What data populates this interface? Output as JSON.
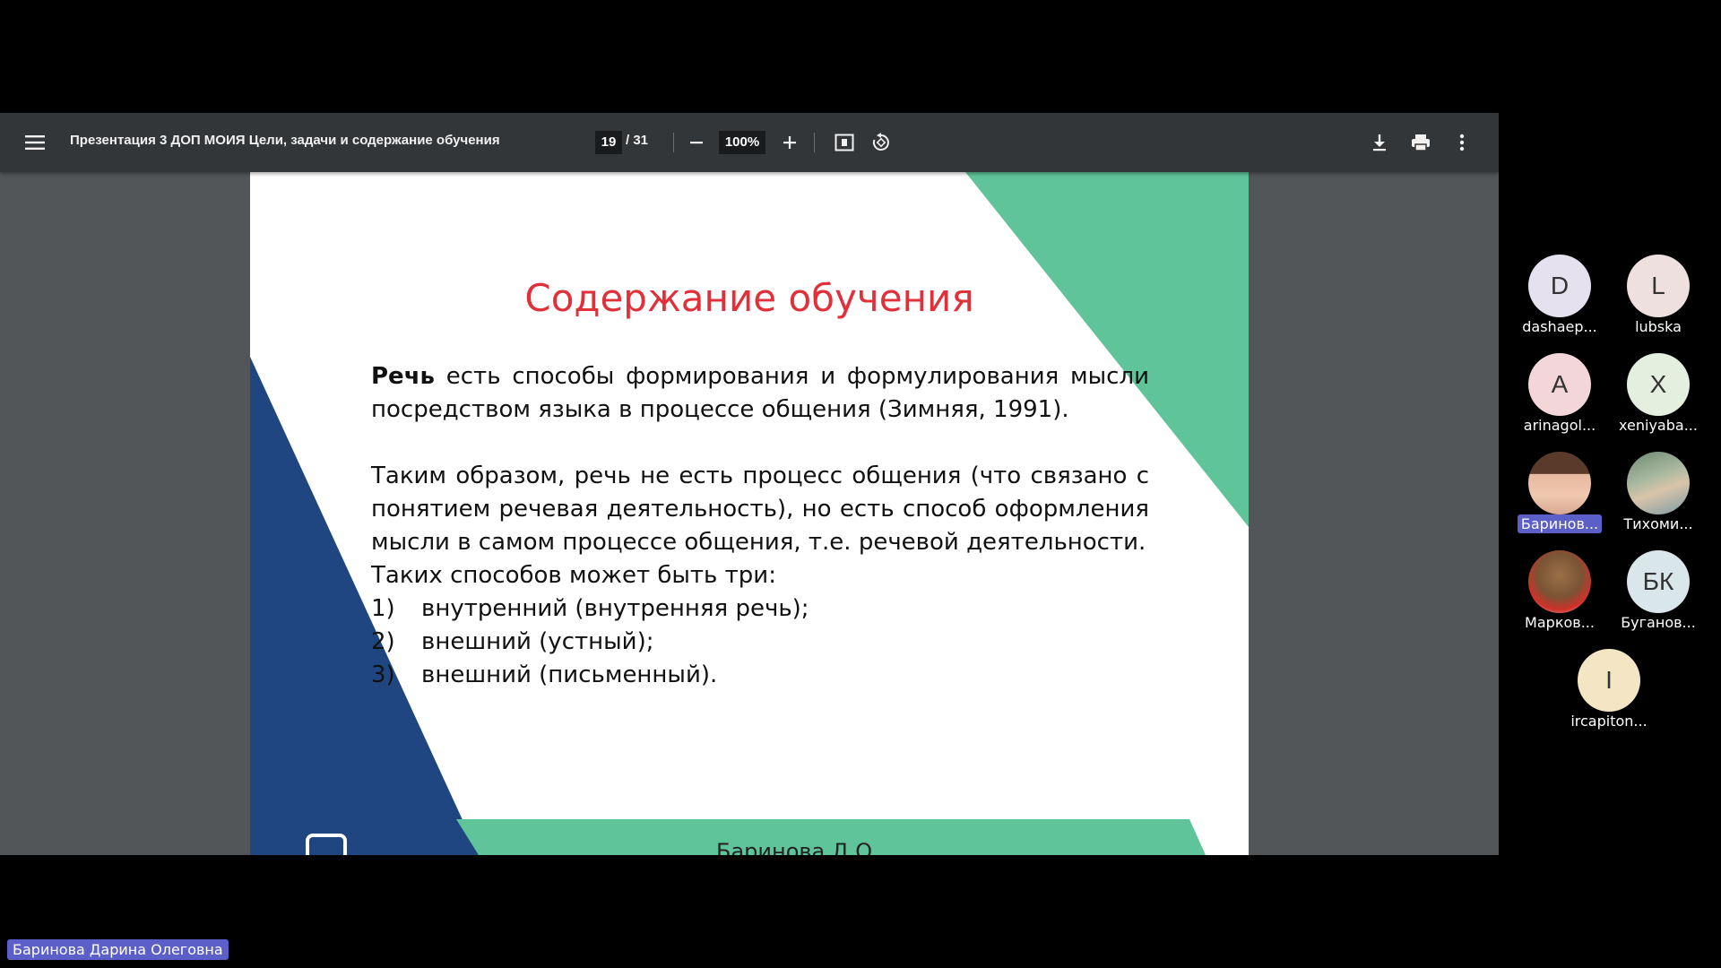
{
  "viewer": {
    "title": "Презентация 3 ДОП МОИЯ Цели, задачи и содержание обучения",
    "current_page": "19",
    "page_total": "/ 31",
    "zoom": "100%"
  },
  "slide": {
    "title": "Содержание обучения",
    "p1_bold": "Речь",
    "p1_rest": " есть способы формирования и формулирования мысли посредством языка в процессе общения (Зимняя, 1991).",
    "p2": "Таким образом, речь не есть процесс общения (что связано с понятием речевая деятельность), но есть способ оформления мысли в самом процессе общения, т.е. речевой деятельности.",
    "p3": "Таких способов может быть три:",
    "list": [
      {
        "num": "1)",
        "text": "внутренний (внутренняя речь);"
      },
      {
        "num": "2)",
        "text": "внешний (устный);"
      },
      {
        "num": "3)",
        "text": "внешний (письменный)."
      }
    ],
    "footer": "Баринова Д.О.",
    "colors": {
      "green": "#5fc49a",
      "blue": "#1f4680",
      "title": "#e0303a"
    }
  },
  "participants": [
    {
      "initial": "D",
      "name": "dashaep...",
      "bg": "#e6e1ef",
      "icon": ""
    },
    {
      "initial": "L",
      "name": "lubska",
      "bg": "#efe0e0",
      "icon": ""
    },
    {
      "initial": "A",
      "name": "arinagol...",
      "bg": "#f2d6da",
      "icon": ""
    },
    {
      "initial": "X",
      "name": "xeniyaba...",
      "bg": "#e4efe0",
      "icon": ""
    },
    {
      "initial": "",
      "name": "Баринов...",
      "bg": "#c89a7c",
      "icon": "photo-avatar"
    },
    {
      "initial": "",
      "name": "Тихоми...",
      "bg": "#8aa0a8",
      "icon": "photo-avatar"
    },
    {
      "initial": "",
      "name": "Марков...",
      "bg": "#b58a5c",
      "icon": "cat-avatar"
    },
    {
      "initial": "БК",
      "name": "Буганов...",
      "bg": "#d9e6ea",
      "icon": ""
    },
    {
      "initial": "I",
      "name": "ircapiton...",
      "bg": "#f4e6c4",
      "icon": ""
    }
  ],
  "speaker": "Баринова Дарина Олеговна"
}
